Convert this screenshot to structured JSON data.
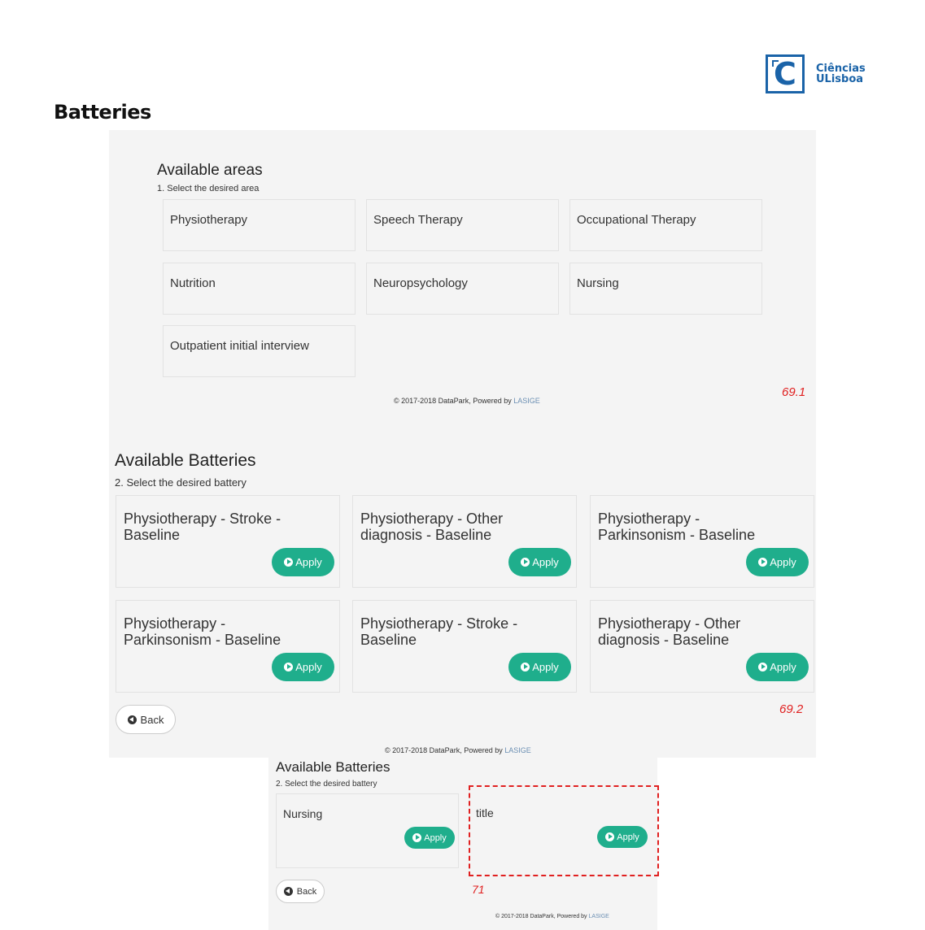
{
  "page_title": "Batteries",
  "logo": {
    "line1": "Ciências",
    "line2": "ULisboa"
  },
  "screen1": {
    "heading": "Available areas",
    "instruction": "1. Select the desired area",
    "areas": [
      "Physiotherapy",
      "Speech Therapy",
      "Occupational Therapy",
      "Nutrition",
      "Neuropsychology",
      "Nursing",
      "Outpatient initial interview"
    ],
    "footer_text": "© 2017-2018 DataPark, Powered by ",
    "footer_brand": "LASIGE",
    "figure_label": "69.1"
  },
  "screen2": {
    "heading": "Available Batteries",
    "instruction": "2. Select the desired battery",
    "batteries": [
      "Physiotherapy - Stroke - Baseline",
      "Physiotherapy - Other diagnosis - Baseline",
      "Physiotherapy - Parkinsonism - Baseline",
      "Physiotherapy - Parkinsonism - Baseline",
      "Physiotherapy - Stroke - Baseline",
      "Physiotherapy - Other diagnosis - Baseline"
    ],
    "apply_label": "Apply",
    "back_label": "Back",
    "footer_text": "© 2017-2018 DataPark, Powered by ",
    "footer_brand": "LASIGE",
    "figure_label": "69.2"
  },
  "screen3": {
    "heading": "Available Batteries",
    "instruction": "2. Select the desired battery",
    "batteries": [
      "Nursing",
      "title"
    ],
    "apply_label": "Apply",
    "back_label": "Back",
    "footer_text": "© 2017-2018 DataPark, Powered by ",
    "footer_brand": "LASIGE",
    "figure_label": "71"
  },
  "colors": {
    "accent": "#1fae8c",
    "brand": "#1a63a8",
    "annotation": "#e02020"
  }
}
